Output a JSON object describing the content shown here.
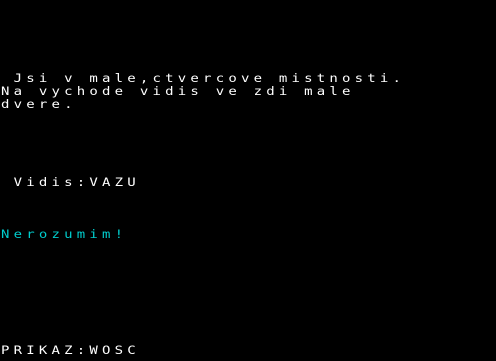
{
  "game": {
    "description_lines": [
      " Jsi v male,ctvercove mistnosti.",
      "Na vychode vidis ve zdi male",
      "dvere."
    ],
    "visible_items": " Vidis:VAZU",
    "response": "Nerozumim!",
    "command_line": "PRIKAZ:WOSC"
  },
  "colors": {
    "background": "#000000",
    "text": "#ffffff",
    "response_text": "#00cccc",
    "border": "#ffffff"
  }
}
